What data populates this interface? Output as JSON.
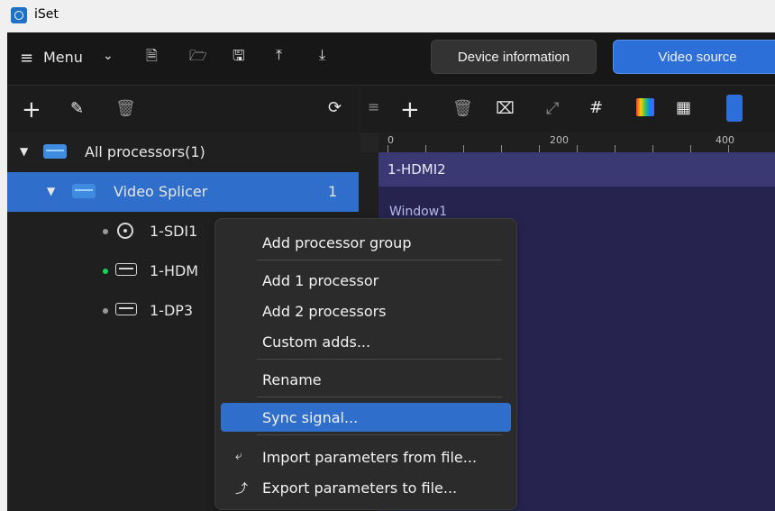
{
  "window": {
    "title": "iSet"
  },
  "toolbar": {
    "menu_label": "Menu",
    "buttons": {
      "device": "Device information",
      "video": "Video source"
    }
  },
  "tree": {
    "root_label": "All processors(1)",
    "processor_label": "Video Splicer",
    "processor_count": "1",
    "inputs": [
      {
        "label": "1-SDI1",
        "status": "gray"
      },
      {
        "label": "1-HDM",
        "status": "green"
      },
      {
        "label": "1-DP3",
        "status": "gray"
      }
    ]
  },
  "canvas": {
    "ruler_labels": [
      "0",
      "200",
      "400"
    ],
    "layer_title": "1-HDMI2",
    "window_label": "Window1"
  },
  "context_menu": {
    "items": [
      "Add processor group",
      "Add 1 processor",
      "Add 2 processors",
      "Custom adds...",
      "Rename",
      "Sync signal...",
      "Import parameters from file...",
      "Export parameters to file..."
    ],
    "active_item": "Sync signal..."
  },
  "colors": {
    "selection_blue": "#2f6fcb",
    "toolbar_bg": "#171717",
    "panel_bg": "#1f1f1f",
    "layer_bg": "#26244f"
  }
}
